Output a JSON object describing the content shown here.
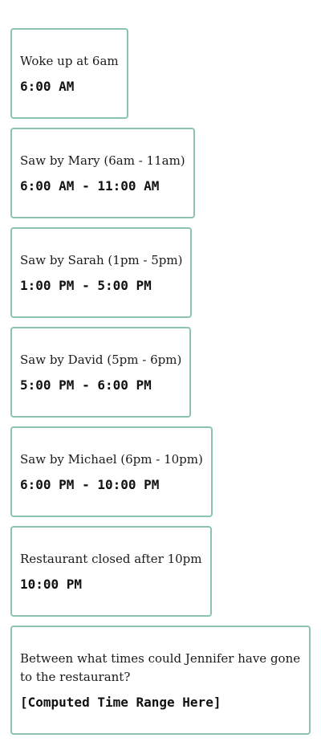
{
  "events": [
    {
      "description": "Woke up at 6am",
      "time": "6:00 AM"
    },
    {
      "description": "Saw by Mary (6am - 11am)",
      "time": "6:00 AM - 11:00 AM"
    },
    {
      "description": "Saw by Sarah (1pm - 5pm)",
      "time": "1:00 PM - 5:00 PM"
    },
    {
      "description": "Saw by David (5pm - 6pm)",
      "time": "5:00 PM - 6:00 PM"
    },
    {
      "description": "Saw by Michael (6pm - 10pm)",
      "time": "6:00 PM - 10:00 PM"
    },
    {
      "description": "Restaurant closed after 10pm",
      "time": "10:00 PM"
    }
  ],
  "question": {
    "text": "Between what times could Jennifer have gone to the restaurant?",
    "answer": "[Computed Time Range Here]"
  },
  "colors": {
    "card_border": "#8cc3ae"
  }
}
